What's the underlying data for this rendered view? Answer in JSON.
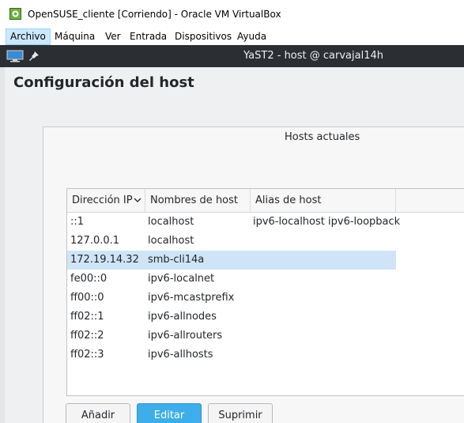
{
  "window": {
    "title": "OpenSUSE_cliente [Corriendo] - Oracle VM VirtualBox"
  },
  "menu": [
    "Archivo",
    "Máquina",
    "Ver",
    "Entrada",
    "Dispositivos",
    "Ayuda"
  ],
  "guest": {
    "title": "YaST2 - host @ carvajal14h"
  },
  "page": {
    "title": "Configuración del host",
    "section_title": "Hosts actuales"
  },
  "table": {
    "columns": [
      "Dirección IP",
      "Nombres de host",
      "Alias de host"
    ],
    "rows": [
      {
        "ip": "::1",
        "host": "localhost",
        "alias": "ipv6-localhost ipv6-loopback"
      },
      {
        "ip": "127.0.0.1",
        "host": "localhost",
        "alias": ""
      },
      {
        "ip": "172.19.14.32",
        "host": "smb-cli14a",
        "alias": "",
        "selected": true
      },
      {
        "ip": "fe00::0",
        "host": "ipv6-localnet",
        "alias": ""
      },
      {
        "ip": "ff00::0",
        "host": "ipv6-mcastprefix",
        "alias": ""
      },
      {
        "ip": "ff02::1",
        "host": "ipv6-allnodes",
        "alias": ""
      },
      {
        "ip": "ff02::2",
        "host": "ipv6-allrouters",
        "alias": ""
      },
      {
        "ip": "ff02::3",
        "host": "ipv6-allhosts",
        "alias": ""
      }
    ]
  },
  "buttons": {
    "add": "Añadir",
    "edit": "Editar",
    "delete": "Suprimir"
  },
  "colors": {
    "selection": "#cfe5f7",
    "accent": "#3daee9",
    "desktop": "#1f6fb8"
  }
}
